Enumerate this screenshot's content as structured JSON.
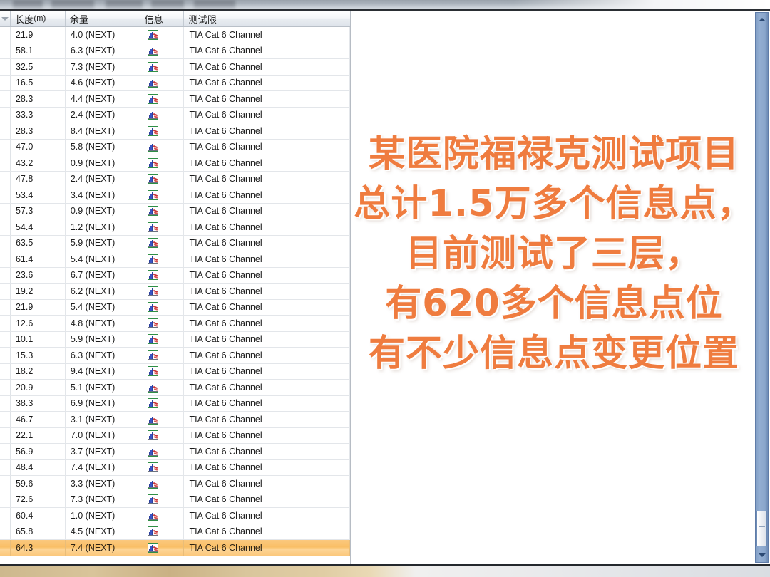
{
  "table": {
    "columns": [
      {
        "key": "sort",
        "label": "",
        "icon": "sort-descending-chevron-icon"
      },
      {
        "key": "length",
        "label": "长度",
        "unit": "(m)"
      },
      {
        "key": "margin",
        "label": "余量",
        "unit": ""
      },
      {
        "key": "info",
        "label": "信息",
        "unit": ""
      },
      {
        "key": "limit",
        "label": "测试限",
        "unit": ""
      }
    ],
    "info_icon": "chart-graph-icon",
    "rows": [
      {
        "length": "21.9",
        "margin": "4.0 (NEXT)",
        "limit": "TIA Cat 6 Channel",
        "selected": false
      },
      {
        "length": "58.1",
        "margin": "6.3 (NEXT)",
        "limit": "TIA Cat 6 Channel",
        "selected": false
      },
      {
        "length": "32.5",
        "margin": "7.3 (NEXT)",
        "limit": "TIA Cat 6 Channel",
        "selected": false
      },
      {
        "length": "16.5",
        "margin": "4.6 (NEXT)",
        "limit": "TIA Cat 6 Channel",
        "selected": false
      },
      {
        "length": "28.3",
        "margin": "4.4 (NEXT)",
        "limit": "TIA Cat 6 Channel",
        "selected": false
      },
      {
        "length": "33.3",
        "margin": "2.4 (NEXT)",
        "limit": "TIA Cat 6 Channel",
        "selected": false
      },
      {
        "length": "28.3",
        "margin": "8.4 (NEXT)",
        "limit": "TIA Cat 6 Channel",
        "selected": false
      },
      {
        "length": "47.0",
        "margin": "5.8 (NEXT)",
        "limit": "TIA Cat 6 Channel",
        "selected": false
      },
      {
        "length": "43.2",
        "margin": "0.9 (NEXT)",
        "limit": "TIA Cat 6 Channel",
        "selected": false
      },
      {
        "length": "47.8",
        "margin": "2.4 (NEXT)",
        "limit": "TIA Cat 6 Channel",
        "selected": false
      },
      {
        "length": "53.4",
        "margin": "3.4 (NEXT)",
        "limit": "TIA Cat 6 Channel",
        "selected": false
      },
      {
        "length": "57.3",
        "margin": "0.9 (NEXT)",
        "limit": "TIA Cat 6 Channel",
        "selected": false
      },
      {
        "length": "54.4",
        "margin": "1.2 (NEXT)",
        "limit": "TIA Cat 6 Channel",
        "selected": false
      },
      {
        "length": "63.5",
        "margin": "5.9 (NEXT)",
        "limit": "TIA Cat 6 Channel",
        "selected": false
      },
      {
        "length": "61.4",
        "margin": "5.4 (NEXT)",
        "limit": "TIA Cat 6 Channel",
        "selected": false
      },
      {
        "length": "23.6",
        "margin": "6.7 (NEXT)",
        "limit": "TIA Cat 6 Channel",
        "selected": false
      },
      {
        "length": "19.2",
        "margin": "6.2 (NEXT)",
        "limit": "TIA Cat 6 Channel",
        "selected": false
      },
      {
        "length": "21.9",
        "margin": "5.4 (NEXT)",
        "limit": "TIA Cat 6 Channel",
        "selected": false
      },
      {
        "length": "12.6",
        "margin": "4.8 (NEXT)",
        "limit": "TIA Cat 6 Channel",
        "selected": false
      },
      {
        "length": "10.1",
        "margin": "5.9 (NEXT)",
        "limit": "TIA Cat 6 Channel",
        "selected": false
      },
      {
        "length": "15.3",
        "margin": "6.3 (NEXT)",
        "limit": "TIA Cat 6 Channel",
        "selected": false
      },
      {
        "length": "18.2",
        "margin": "9.4 (NEXT)",
        "limit": "TIA Cat 6 Channel",
        "selected": false
      },
      {
        "length": "20.9",
        "margin": "5.1 (NEXT)",
        "limit": "TIA Cat 6 Channel",
        "selected": false
      },
      {
        "length": "38.3",
        "margin": "6.9 (NEXT)",
        "limit": "TIA Cat 6 Channel",
        "selected": false
      },
      {
        "length": "46.7",
        "margin": "3.1 (NEXT)",
        "limit": "TIA Cat 6 Channel",
        "selected": false
      },
      {
        "length": "22.1",
        "margin": "7.0 (NEXT)",
        "limit": "TIA Cat 6 Channel",
        "selected": false
      },
      {
        "length": "56.9",
        "margin": "3.7 (NEXT)",
        "limit": "TIA Cat 6 Channel",
        "selected": false
      },
      {
        "length": "48.4",
        "margin": "7.4 (NEXT)",
        "limit": "TIA Cat 6 Channel",
        "selected": false
      },
      {
        "length": "59.6",
        "margin": "3.3 (NEXT)",
        "limit": "TIA Cat 6 Channel",
        "selected": false
      },
      {
        "length": "72.6",
        "margin": "7.3 (NEXT)",
        "limit": "TIA Cat 6 Channel",
        "selected": false
      },
      {
        "length": "60.4",
        "margin": "1.0 (NEXT)",
        "limit": "TIA Cat 6 Channel",
        "selected": false
      },
      {
        "length": "65.8",
        "margin": "4.5 (NEXT)",
        "limit": "TIA Cat 6 Channel",
        "selected": false
      },
      {
        "length": "64.3",
        "margin": "7.4 (NEXT)",
        "limit": "TIA Cat 6 Channel",
        "selected": true
      }
    ]
  },
  "caption": {
    "lines": [
      "某医院福禄克测试项目",
      "总计1.5万多个信息点，",
      "目前测试了三层，",
      "有620多个信息点位",
      "有不少信息点变更位置"
    ],
    "color": "#ef7c3f"
  },
  "scrollbar": {
    "up_arrow": "scroll-up-arrow-icon",
    "down_arrow": "scroll-down-arrow-icon",
    "track_color": "#8aa6cc"
  },
  "colors": {
    "selected_row": "#f9bf66",
    "header_bg": "#e9edf1",
    "grid_line": "#e3e6ea",
    "icon_border_green": "#2f8f46"
  }
}
